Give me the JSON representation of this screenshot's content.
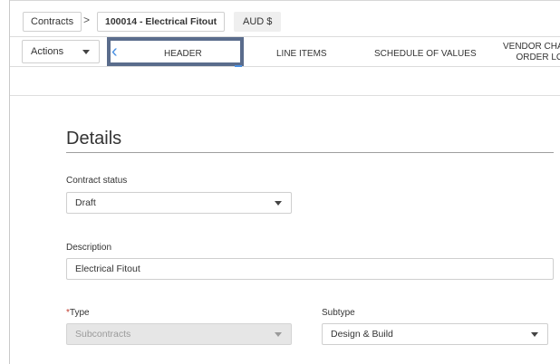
{
  "breadcrumb": {
    "root": "Contracts",
    "separator": ">",
    "current": "100014 - Electrical Fitout"
  },
  "currency": "AUD  $",
  "actions_label": "Actions",
  "tabs": [
    {
      "label": "HEADER"
    },
    {
      "label": "LINE ITEMS"
    },
    {
      "label": "SCHEDULE OF VALUES"
    },
    {
      "label": "VENDOR CHA",
      "label2": "ORDER LO"
    }
  ],
  "details": {
    "heading": "Details",
    "contract_status": {
      "label": "Contract status",
      "value": "Draft"
    },
    "description": {
      "label": "Description",
      "value": "Electrical Fitout"
    },
    "type": {
      "required_mark": "*",
      "label": "Type",
      "value": "Subcontracts"
    },
    "subtype": {
      "label": "Subtype",
      "value": "Design & Build"
    }
  },
  "colors": {
    "tab_highlight_border": "#5a6c8c",
    "accent": "#4a90e2"
  }
}
